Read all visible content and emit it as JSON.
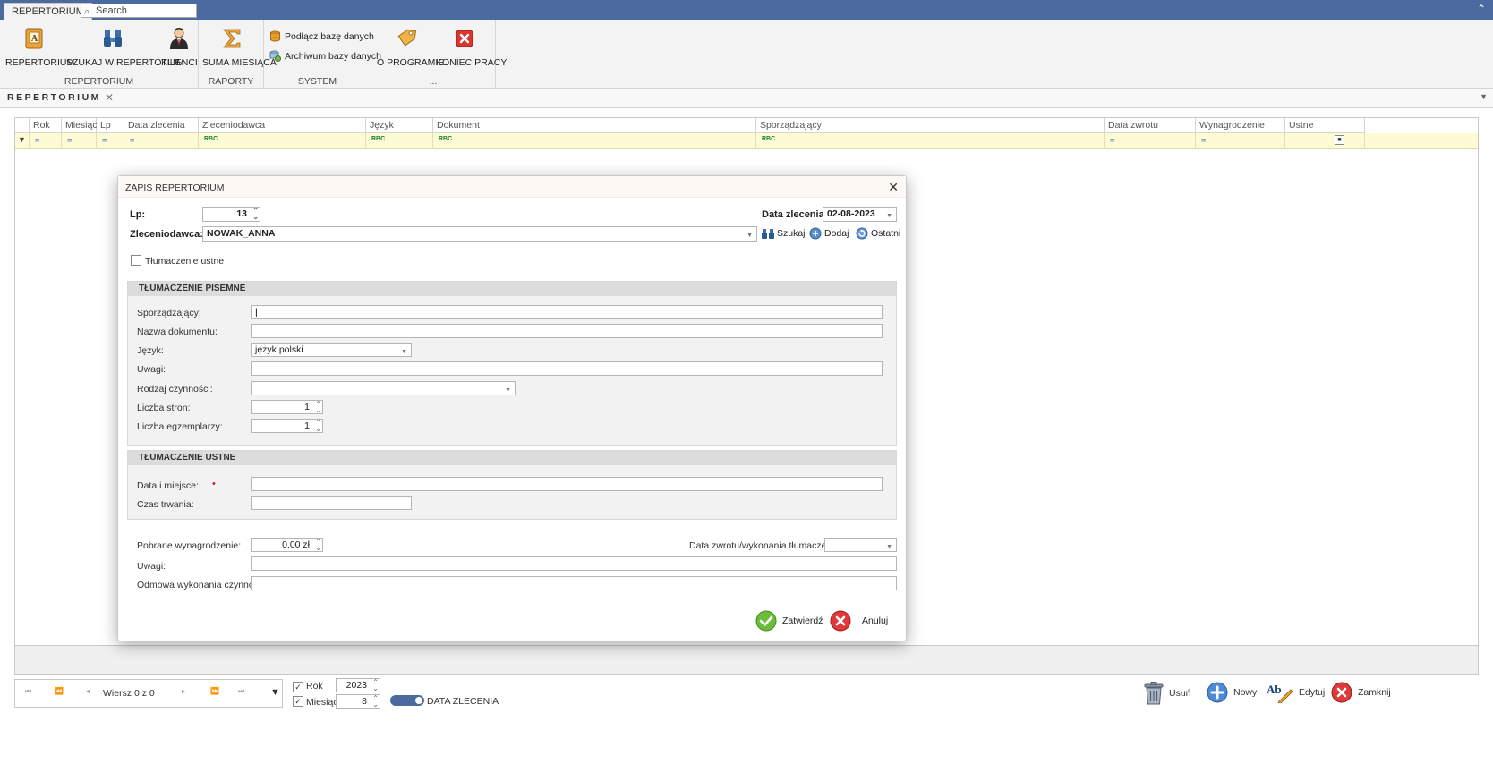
{
  "titlebar": {
    "app_tab": "REPERTORIUM",
    "search_placeholder": "Search"
  },
  "ribbon": {
    "groups": [
      {
        "label": "REPERTORIUM",
        "buttons": [
          "REPERTORIUM",
          "SZUKAJ W REPERTOTIUM",
          "KLIENCI"
        ]
      },
      {
        "label": "RAPORTY",
        "buttons": [
          "SUMA MIESIĄCA"
        ]
      },
      {
        "label": "SYSTEM",
        "buttons": [
          "Podłącz bazę danych",
          "Archiwum bazy danych"
        ]
      },
      {
        "label": "...",
        "buttons": [
          "O PROGRAMIE",
          "KONIEC PRACY"
        ]
      }
    ]
  },
  "doc_tab": {
    "label": "REPERTORIUM"
  },
  "grid": {
    "columns": [
      "Rok",
      "Miesiąc",
      "Lp",
      "Data zlecenia",
      "Zleceniodawca",
      "Język",
      "Dokument",
      "Sporządzający",
      "Data zwrotu",
      "Wynagrodzenie",
      "Ustne"
    ],
    "filter_eq": "=",
    "filter_contains": "RBC"
  },
  "modal": {
    "title": "ZAPIS REPERTORIUM",
    "lp_label": "Lp:",
    "lp_value": "13",
    "data_zlecenia_label": "Data zlecenia:",
    "data_zlecenia_value": "02-08-2023",
    "zleceniodawca_label": "Zleceniodawca:",
    "zleceniodawca_value": "NOWAK_ANNA",
    "actions": {
      "szukaj": "Szukaj",
      "dodaj": "Dodaj",
      "ostatni": "Ostatni"
    },
    "ustne_checkbox": "Tłumaczenie ustne",
    "pisemne": {
      "title": "TŁUMACZENIE PISEMNE",
      "sporzadzajacy_label": "Sporządzający:",
      "sporzadzajacy_value": "",
      "nazwa_label": "Nazwa dokumentu:",
      "jezyk_label": "Język:",
      "jezyk_value": "język polski",
      "uwagi_label": "Uwagi:",
      "rodzaj_label": "Rodzaj czynności:",
      "liczba_stron_label": "Liczba stron:",
      "liczba_stron_value": "1",
      "liczba_egz_label": "Liczba egzemplarzy:",
      "liczba_egz_value": "1"
    },
    "ustne": {
      "title": "TŁUMACZENIE USTNE",
      "data_miejsce_label": "Data i miejsce:",
      "czas_label": "Czas trwania:"
    },
    "wynagrodzenie_label": "Pobrane wynagrodzenie:",
    "wynagrodzenie_value": "0,00 zł",
    "data_zwrotu_label": "Data zwrotu/wykonania tłumaczenia:",
    "uwagi_label": "Uwagi:",
    "odmowa_label": "Odmowa wykonania czynności:",
    "confirm": "Zatwierdź",
    "cancel": "Anuluj"
  },
  "bottom": {
    "nav_position": "Wiersz 0 z 0",
    "rok_label": "Rok",
    "rok_value": "2023",
    "miesiac_label": "Miesiąc",
    "miesiac_value": "8",
    "toggle_label": "DATA ZLECENIA",
    "usun": "Usuń",
    "nowy": "Nowy",
    "edytuj": "Edytuj",
    "zamknij": "Zamknij"
  },
  "colors": {
    "titlebar": "#4a6aa0",
    "filter_row": "#fdfbd6",
    "toggle": "#4a6aa0",
    "delete_red": "#d9262c",
    "confirm_green": "#5cb02c",
    "add_blue": "#3d7ccc"
  }
}
